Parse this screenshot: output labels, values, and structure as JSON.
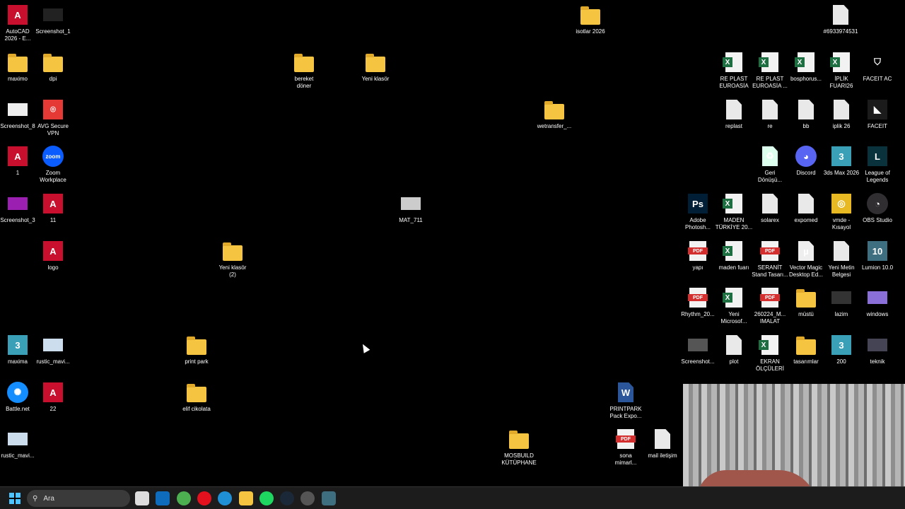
{
  "desktop_icons": [
    {
      "label": "AutoCAD\n2026 - E...",
      "icon": "autocad-icon",
      "t": "acad",
      "txt": "A"
    },
    {
      "label": "Screenshot_1",
      "icon": "image-icon",
      "t": "img",
      "bg": "#222"
    },
    {
      "label": "maximo",
      "icon": "folder-icon",
      "t": "folder"
    },
    {
      "label": "dpi",
      "icon": "folder-icon",
      "t": "folder"
    },
    {
      "label": "bereket\ndöner",
      "icon": "folder-icon",
      "t": "folder"
    },
    {
      "label": "Yeni klasör",
      "icon": "folder-icon",
      "t": "folder"
    },
    {
      "label": "isotlar 2026",
      "icon": "folder-icon",
      "t": "folder"
    },
    {
      "label": "#6933974531",
      "icon": "document-icon",
      "t": "doc"
    },
    {
      "label": "Screenshot_8",
      "icon": "image-icon",
      "t": "img",
      "bg": "#eee"
    },
    {
      "label": "AVG Secure\nVPN",
      "icon": "avg-vpn-icon",
      "t": "acad",
      "bg": "#e53935",
      "txt": "⌾"
    },
    {
      "label": "wetransfer_...",
      "icon": "folder-icon",
      "t": "folder"
    },
    {
      "label": "1",
      "icon": "fbx-icon",
      "t": "fbx",
      "txt": "A"
    },
    {
      "label": "Zoom\nWorkplace",
      "icon": "zoom-icon",
      "t": "round",
      "bg": "#0b5cff",
      "txt": "zoom"
    },
    {
      "label": "Screenshot_3",
      "icon": "image-icon",
      "t": "img",
      "bg": "#9b1fb0"
    },
    {
      "label": "11",
      "icon": "fbx-icon",
      "t": "fbx",
      "txt": "A"
    },
    {
      "label": "MAT_711",
      "icon": "image-icon",
      "t": "img",
      "bg": "#ccc"
    },
    {
      "label": "logo",
      "icon": "fbx-icon",
      "t": "fbx",
      "txt": "A"
    },
    {
      "label": "Yeni klasör\n(2)",
      "icon": "folder-icon",
      "t": "folder"
    },
    {
      "label": "maxima",
      "icon": "3dsmax-icon",
      "t": "max",
      "txt": "3"
    },
    {
      "label": "rustic_mavi...",
      "icon": "image-icon",
      "t": "img",
      "bg": "#cde"
    },
    {
      "label": "print park",
      "icon": "folder-icon",
      "t": "folder"
    },
    {
      "label": "Battle.net",
      "icon": "battlenet-icon",
      "t": "round",
      "bg": "#148eff",
      "txt": "✺"
    },
    {
      "label": "22",
      "icon": "fbx-icon",
      "t": "fbx",
      "txt": "A"
    },
    {
      "label": "elif cikolata",
      "icon": "folder-icon",
      "t": "folder"
    },
    {
      "label": "PRINTPARK\nPack Expo...",
      "icon": "word-icon",
      "t": "doc",
      "txt": "W",
      "bg": "#2b579a"
    },
    {
      "label": "rustic_mavi...",
      "icon": "image-icon",
      "t": "img",
      "bg": "#cde"
    },
    {
      "label": "MOSBUILD\nKÜTÜPHANE",
      "icon": "folder-icon",
      "t": "folder"
    },
    {
      "label": "sona\nmimarl...",
      "icon": "pdf-icon",
      "t": "pdf"
    },
    {
      "label": "mail iletişim",
      "icon": "document-icon",
      "t": "doc"
    },
    {
      "label": "RE PLAST\nEUROASİA",
      "icon": "excel-icon",
      "t": "xls"
    },
    {
      "label": "RE PLAST\nEUROASİA ...",
      "icon": "excel-icon",
      "t": "xls"
    },
    {
      "label": "bosphorus...",
      "icon": "excel-icon",
      "t": "xls"
    },
    {
      "label": "İPLİK\nFUARI26",
      "icon": "excel-icon",
      "t": "xls"
    },
    {
      "label": "FACEIT AC",
      "icon": "faceit-ac-icon",
      "t": "acad",
      "bg": "#000",
      "txt": "⛉"
    },
    {
      "label": "replast",
      "icon": "document-icon",
      "t": "doc"
    },
    {
      "label": "re",
      "icon": "document-icon",
      "t": "doc"
    },
    {
      "label": "bb",
      "icon": "document-icon",
      "t": "doc"
    },
    {
      "label": "iplik 26",
      "icon": "document-icon",
      "t": "doc"
    },
    {
      "label": "FACEIT",
      "icon": "faceit-icon",
      "t": "acad",
      "bg": "#1b1b1b",
      "txt": "◣"
    },
    {
      "label": "Geri\nDönüşü...",
      "icon": "recycle-bin-icon",
      "t": "doc",
      "txt": "♻",
      "bg": "#dfe"
    },
    {
      "label": "Discord",
      "icon": "discord-icon",
      "t": "round",
      "bg": "#5865f2",
      "txt": "◕"
    },
    {
      "label": "3ds Max 2026",
      "icon": "3dsmax-icon",
      "t": "max",
      "txt": "3"
    },
    {
      "label": "League of\nLegends",
      "icon": "league-icon",
      "t": "acad",
      "bg": "#0a323c",
      "txt": "L"
    },
    {
      "label": "Adobe\nPhotosh...",
      "icon": "photoshop-icon",
      "t": "acad",
      "bg": "#001e36",
      "txt": "Ps"
    },
    {
      "label": "MADEN\nTÜRKİYE 20...",
      "icon": "excel-icon",
      "t": "xls"
    },
    {
      "label": "solarex",
      "icon": "document-icon",
      "t": "doc"
    },
    {
      "label": "expomed",
      "icon": "document-icon",
      "t": "doc"
    },
    {
      "label": "vmde -\nKısayol",
      "icon": "vector-magic-icon",
      "t": "acad",
      "bg": "#e8b923",
      "txt": "◎"
    },
    {
      "label": "OBS Studio",
      "icon": "obs-icon",
      "t": "round",
      "bg": "#302e31",
      "txt": "◔"
    },
    {
      "label": "yapı",
      "icon": "pdf-icon",
      "t": "pdf"
    },
    {
      "label": "maden fuarı",
      "icon": "excel-icon",
      "t": "xls"
    },
    {
      "label": "SERANİT\nStand Tasarı...",
      "icon": "pdf-icon",
      "t": "pdf"
    },
    {
      "label": "Vector Magic\nDesktop Ed...",
      "icon": "torrent-icon",
      "t": "doc",
      "txt": "µ",
      "bg": "#eee"
    },
    {
      "label": "Yeni Metin\nBelgesi",
      "icon": "document-icon",
      "t": "doc"
    },
    {
      "label": "Lumion 10.0",
      "icon": "lumion-icon",
      "t": "acad",
      "bg": "#3d6f80",
      "txt": "10"
    },
    {
      "label": "Rhythm_20...",
      "icon": "pdf-icon",
      "t": "pdf"
    },
    {
      "label": "Yeni\nMicrosof...",
      "icon": "excel-icon",
      "t": "xls"
    },
    {
      "label": "260224_M...\nIMALAT",
      "icon": "pdf-icon",
      "t": "pdf"
    },
    {
      "label": "müstü",
      "icon": "folder-icon",
      "t": "folder"
    },
    {
      "label": "lazim",
      "icon": "image-icon",
      "t": "img",
      "bg": "#333"
    },
    {
      "label": "windows",
      "icon": "image-icon",
      "t": "img",
      "bg": "#8a6fd8"
    },
    {
      "label": "Screenshot...",
      "icon": "image-icon",
      "t": "img",
      "bg": "#555"
    },
    {
      "label": "plot",
      "icon": "document-icon",
      "t": "doc"
    },
    {
      "label": "EKRAN\nÖLÇÜLERİ",
      "icon": "excel-icon",
      "t": "xls"
    },
    {
      "label": "tasarımlar",
      "icon": "folder-icon",
      "t": "folder"
    },
    {
      "label": "200",
      "icon": "3dsmax-icon",
      "t": "max",
      "txt": "3"
    },
    {
      "label": "teknik",
      "icon": "image-icon",
      "t": "img",
      "bg": "#445"
    }
  ],
  "taskbar": {
    "search_placeholder": "Ara",
    "apps": [
      {
        "name": "task-view",
        "color": "#ddd"
      },
      {
        "name": "outlook",
        "color": "#0f6cbd"
      },
      {
        "name": "chrome",
        "color": "#4caf50"
      },
      {
        "name": "opera",
        "color": "#e3101e"
      },
      {
        "name": "edge",
        "color": "#1f8fd6"
      },
      {
        "name": "file-explorer",
        "color": "#f5c542"
      },
      {
        "name": "spotify",
        "color": "#1ed760"
      },
      {
        "name": "steam",
        "color": "#1b2838"
      },
      {
        "name": "obs",
        "color": "#555"
      },
      {
        "name": "lumion",
        "color": "#3d6f80"
      }
    ]
  }
}
